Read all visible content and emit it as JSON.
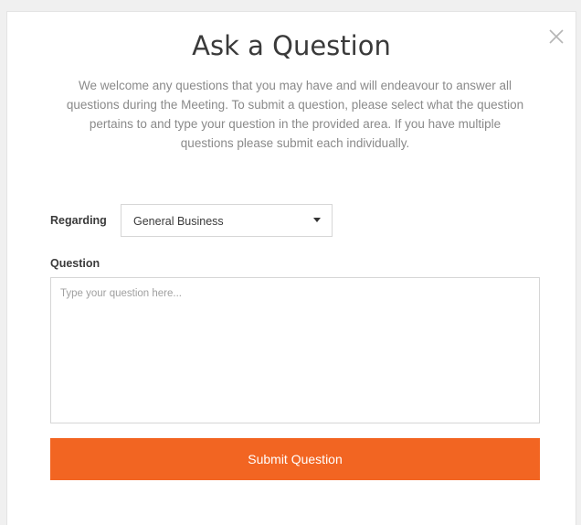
{
  "modal": {
    "title": "Ask a Question",
    "intro": "We welcome any questions that you may have and will endeavour to answer all questions during the Meeting. To submit a question, please select what the question pertains to and type your question in the provided area. If you have multiple questions please submit each individually.",
    "close_icon": "close-icon"
  },
  "form": {
    "regarding_label": "Regarding",
    "regarding_selected": "General Business",
    "question_label": "Question",
    "question_placeholder": "Type your question here...",
    "question_value": "",
    "submit_label": "Submit Question"
  },
  "colors": {
    "accent": "#f26522",
    "title_text": "#3a3a3a",
    "body_text": "#8a8a8a",
    "border": "#d6d6d6"
  }
}
